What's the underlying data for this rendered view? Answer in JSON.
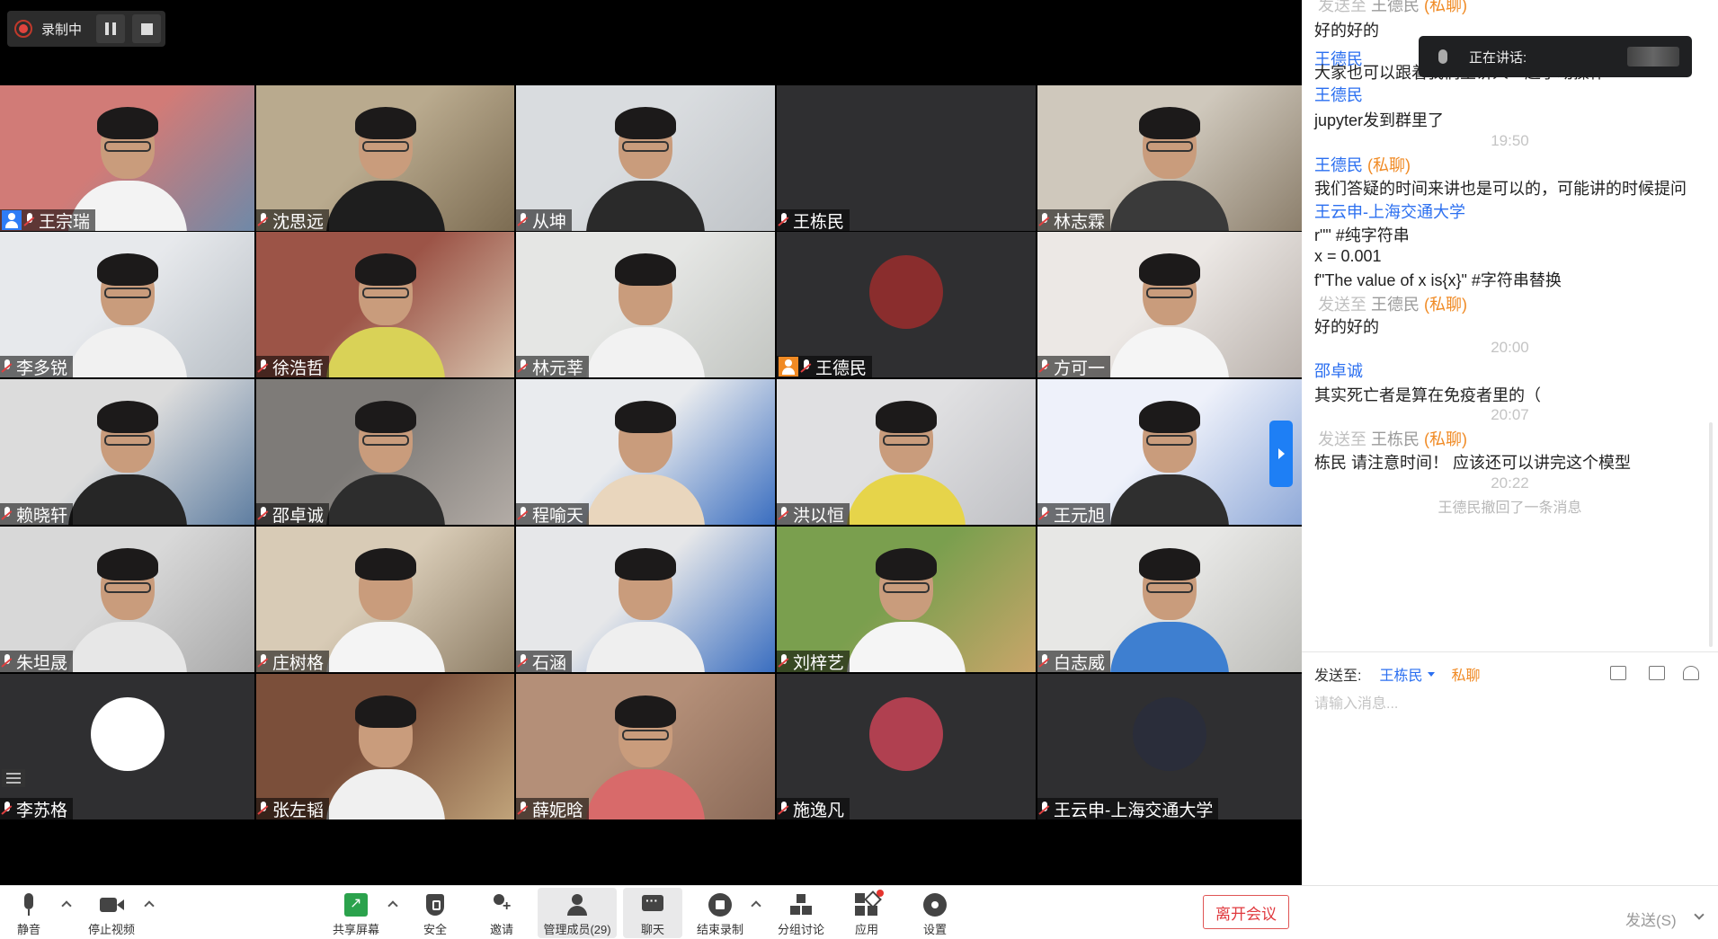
{
  "recording": {
    "label": "录制中"
  },
  "speaking": {
    "label": "正在讲话:"
  },
  "participants": [
    {
      "name": "王宗瑞",
      "host": true,
      "bg": "#d17b77",
      "bg2": "#6f89a8",
      "body": "#f3f3f3",
      "glasses": true,
      "mic_on": true
    },
    {
      "name": "沈思远",
      "bg": "#b9aa8e",
      "bg2": "#7c6c52",
      "body": "#1e1e1e",
      "glasses": true
    },
    {
      "name": "从坤",
      "bg": "#d9dcdf",
      "bg2": "#bfc3c7",
      "body": "#2a2a2a",
      "glasses": true
    },
    {
      "name": "王栋民",
      "empty": true
    },
    {
      "name": "林志霖",
      "bg": "#cfc8bc",
      "bg2": "#8c7f6c",
      "body": "#3a3a3a",
      "glasses": true
    },
    {
      "name": "李多锐",
      "bg": "#e7e9ec",
      "bg2": "#b8bfc6",
      "body": "#f1f1f1",
      "glasses": true
    },
    {
      "name": "徐浩哲",
      "bg": "#9c5447",
      "bg2": "#d8c3ad",
      "body": "#d9d257",
      "glasses": true
    },
    {
      "name": "林元莘",
      "bg": "#e5e6e4",
      "bg2": "#c2c5c1",
      "body": "#f2f2f2",
      "glasses": false
    },
    {
      "name": "王德民",
      "avatar": true,
      "host_orange": true,
      "avatar_color": "#8a2d2d"
    },
    {
      "name": "方可一",
      "bg": "#ece8e5",
      "bg2": "#b9b1ab",
      "body": "#f5f5f5",
      "glasses": true
    },
    {
      "name": "赖晓轩",
      "bg": "#dcdcdc",
      "bg2": "#5f7ea1",
      "body": "#262626",
      "glasses": true
    },
    {
      "name": "邵卓诚",
      "bg": "#7e7b78",
      "bg2": "#b3aca6",
      "body": "#2d2d2d",
      "glasses": true
    },
    {
      "name": "程喻天",
      "bg": "#e9ebee",
      "bg2": "#3a6ec0",
      "body": "#e9d6bd",
      "glasses": false
    },
    {
      "name": "洪以恒",
      "bg": "#e0e0e2",
      "bg2": "#bfc0c4",
      "body": "#e6d44a",
      "glasses": true
    },
    {
      "name": "王元旭",
      "bg": "#eef1fa",
      "bg2": "#8fa9d8",
      "body": "#2f2f2f",
      "glasses": true,
      "arrow": true
    },
    {
      "name": "朱坦晟",
      "bg": "#d8d8d8",
      "bg2": "#a9a9a9",
      "body": "#e7e7e7",
      "glasses": true
    },
    {
      "name": "庄树格",
      "bg": "#d8cbb6",
      "bg2": "#8e7e66",
      "body": "#f4f4f4",
      "glasses": false
    },
    {
      "name": "石涵",
      "bg": "#e6e7e9",
      "bg2": "#3a6ec0",
      "body": "#efefef",
      "glasses": false
    },
    {
      "name": "刘梓艺",
      "bg": "#7a9f4e",
      "bg2": "#c9a56a",
      "body": "#f5f5f5",
      "glasses": true
    },
    {
      "name": "白志威",
      "bg": "#e7e7e5",
      "bg2": "#bdbdb9",
      "body": "#3e7fd0",
      "glasses": true
    },
    {
      "name": "李苏格",
      "avatar": true,
      "avatar_color": "#ffffff",
      "list_icon": true
    },
    {
      "name": "张左韬",
      "bg": "#7b4f3a",
      "bg2": "#c0a37a",
      "body": "#f0f0f0",
      "glasses": false
    },
    {
      "name": "薛妮晗",
      "bg": "#b48f78",
      "bg2": "#8a6a58",
      "body": "#d86a6a",
      "glasses": true
    },
    {
      "name": "施逸凡",
      "avatar": true,
      "avatar_color": "#b04050"
    },
    {
      "name": "王云申-上海交通大学",
      "avatar": true,
      "avatar_color": "#2a2d3a"
    }
  ],
  "chat": {
    "messages": [
      {
        "kind": "sentto",
        "prefix": "发送至",
        "who": "王德民",
        "priv": "(私聊)"
      },
      {
        "kind": "text",
        "text": "好的好的"
      },
      {
        "kind": "sender",
        "text": "王德民"
      },
      {
        "kind": "text",
        "text": "大家也可以跟着我们主讲人一起手动操作"
      },
      {
        "kind": "sender",
        "text": "王德民"
      },
      {
        "kind": "text",
        "text": "jupyter发到群里了"
      },
      {
        "kind": "time",
        "text": "19:50"
      },
      {
        "kind": "sender",
        "text": "王德民",
        "priv": "(私聊)"
      },
      {
        "kind": "text",
        "text": "我们答疑的时间来讲也是可以的，可能讲的时候提问"
      },
      {
        "kind": "sender",
        "text": "王云申-上海交通大学"
      },
      {
        "kind": "text",
        "text": "r\"\"  #纯字符串"
      },
      {
        "kind": "text",
        "text": "x = 0.001"
      },
      {
        "kind": "text",
        "text": "f\"The value of x is{x}\"  #字符串替换"
      },
      {
        "kind": "sentto",
        "prefix": "发送至",
        "who": "王德民",
        "priv": "(私聊)"
      },
      {
        "kind": "text",
        "text": "好的好的"
      },
      {
        "kind": "time",
        "text": "20:00"
      },
      {
        "kind": "sender",
        "text": "邵卓诚"
      },
      {
        "kind": "text",
        "text": "其实死亡者是算在免疫者里的（"
      },
      {
        "kind": "time",
        "text": "20:07"
      },
      {
        "kind": "sentto",
        "prefix": "发送至",
        "who": "王栋民",
        "priv": "(私聊)"
      },
      {
        "kind": "text",
        "text": "栋民 请注意时间！ 应该还可以讲完这个模型"
      },
      {
        "kind": "time",
        "text": "20:22"
      },
      {
        "kind": "sys",
        "text": "王德民撤回了一条消息"
      }
    ],
    "send_to_label": "发送至:",
    "send_to_target": "王栋民",
    "send_to_mode": "私聊",
    "input_placeholder": "请输入消息..."
  },
  "toolbar": {
    "mute": "静音",
    "stop_video": "停止视频",
    "share": "共享屏幕",
    "security": "安全",
    "invite": "邀请",
    "participants": "管理成员(29)",
    "chat": "聊天",
    "end_record": "结束录制",
    "breakout": "分组讨论",
    "apps": "应用",
    "settings": "设置",
    "leave": "离开会议",
    "send": "发送(S)"
  }
}
